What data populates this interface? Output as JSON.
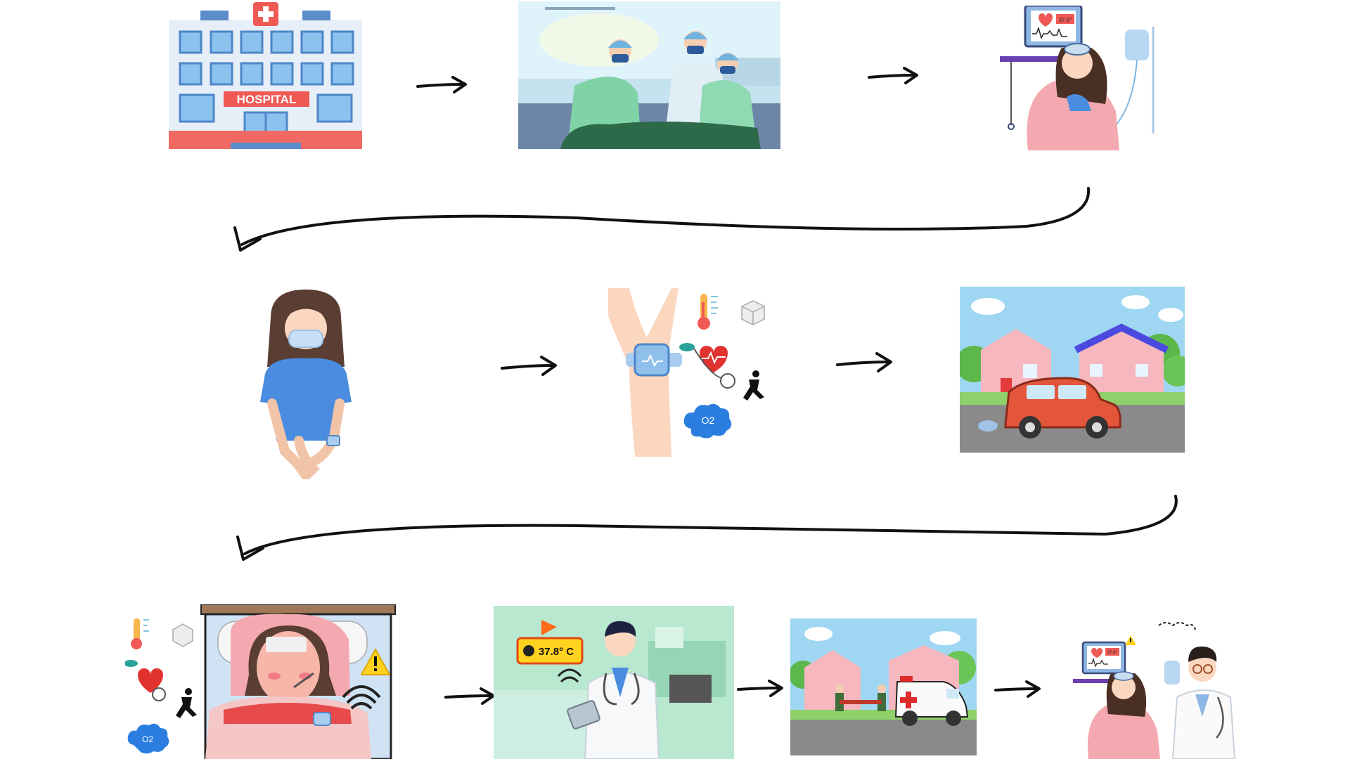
{
  "hospital": {
    "sign": "HOSPITAL",
    "brand_color": "#f06a63",
    "wall_color": "#e8f0f8",
    "window_color": "#7ab6e6"
  },
  "icu_monitor": {
    "temperature": "37.6°"
  },
  "home_alert": {
    "temperature_badge": "37.8° C",
    "alert_color": "#ff6b1a"
  },
  "ward_monitor": {
    "temperature": "37.8°"
  },
  "sensors": {
    "oxygen_label": "O2"
  },
  "colors": {
    "scrub": "#7ed6a8",
    "patient_shirt": "#4a8de0",
    "skin": "#fcd7c0",
    "car": "#e3563c",
    "ambulance_cross": "#e02b2b"
  }
}
